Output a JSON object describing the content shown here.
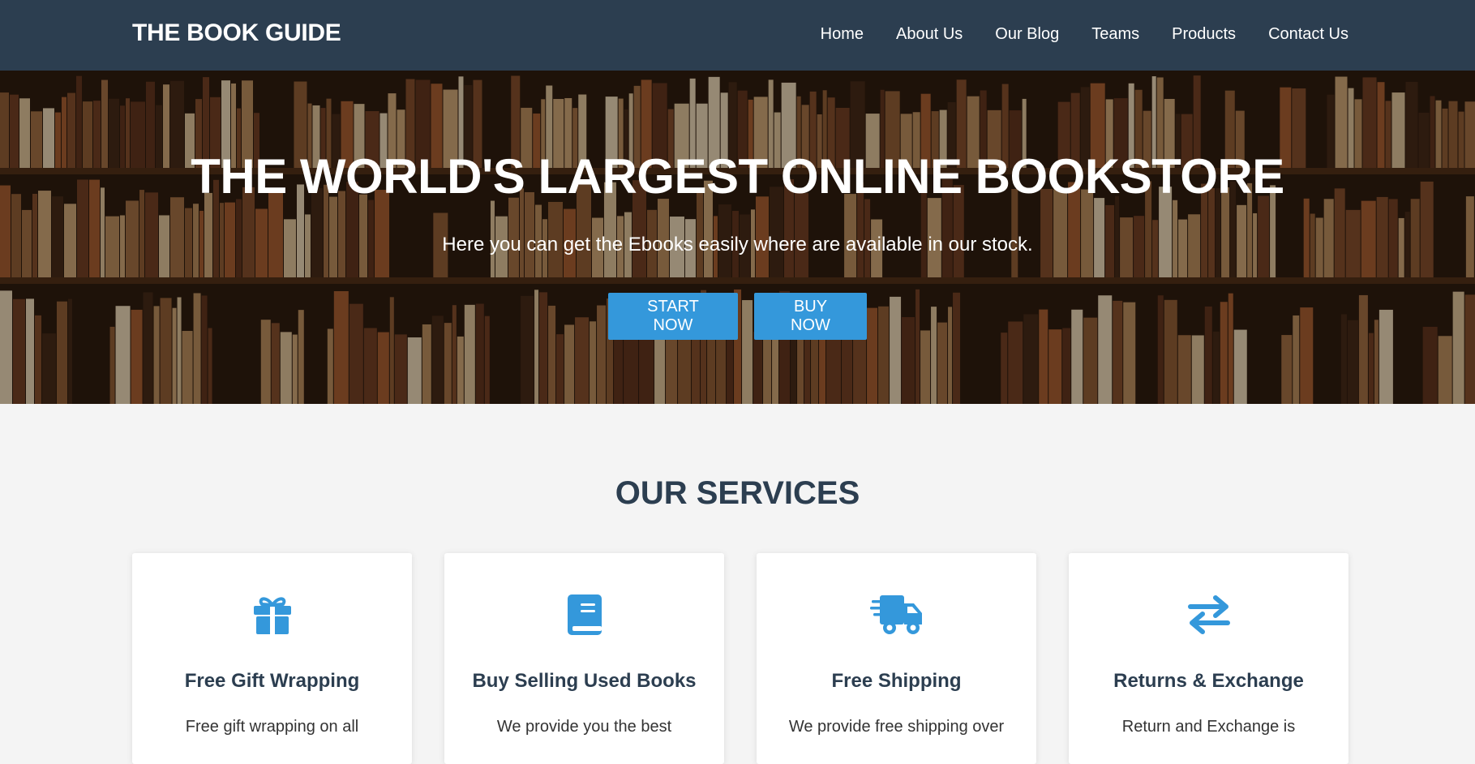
{
  "brand": "THE BOOK GUIDE",
  "nav": {
    "items": [
      "Home",
      "About Us",
      "Our Blog",
      "Teams",
      "Products",
      "Contact Us"
    ]
  },
  "hero": {
    "title": "THE WORLD'S LARGEST ONLINE BOOKSTORE",
    "subtitle": "Here you can get the Ebooks easily where are available in our stock.",
    "start_label": "START NOW",
    "buy_label": "BUY NOW"
  },
  "services": {
    "title": "OUR SERVICES",
    "cards": [
      {
        "icon": "gift-icon",
        "title": "Free Gift Wrapping",
        "text": "Free gift wrapping on all"
      },
      {
        "icon": "book-icon",
        "title": "Buy Selling Used Books",
        "text": "We provide you the best"
      },
      {
        "icon": "truck-icon",
        "title": "Free Shipping",
        "text": "We provide free shipping over"
      },
      {
        "icon": "exchange-icon",
        "title": "Returns & Exchange",
        "text": "Return and Exchange is"
      }
    ]
  },
  "colors": {
    "navbar": "#2c3e50",
    "accent": "#3498db",
    "heading": "#2c3e50",
    "background": "#f4f4f4"
  }
}
